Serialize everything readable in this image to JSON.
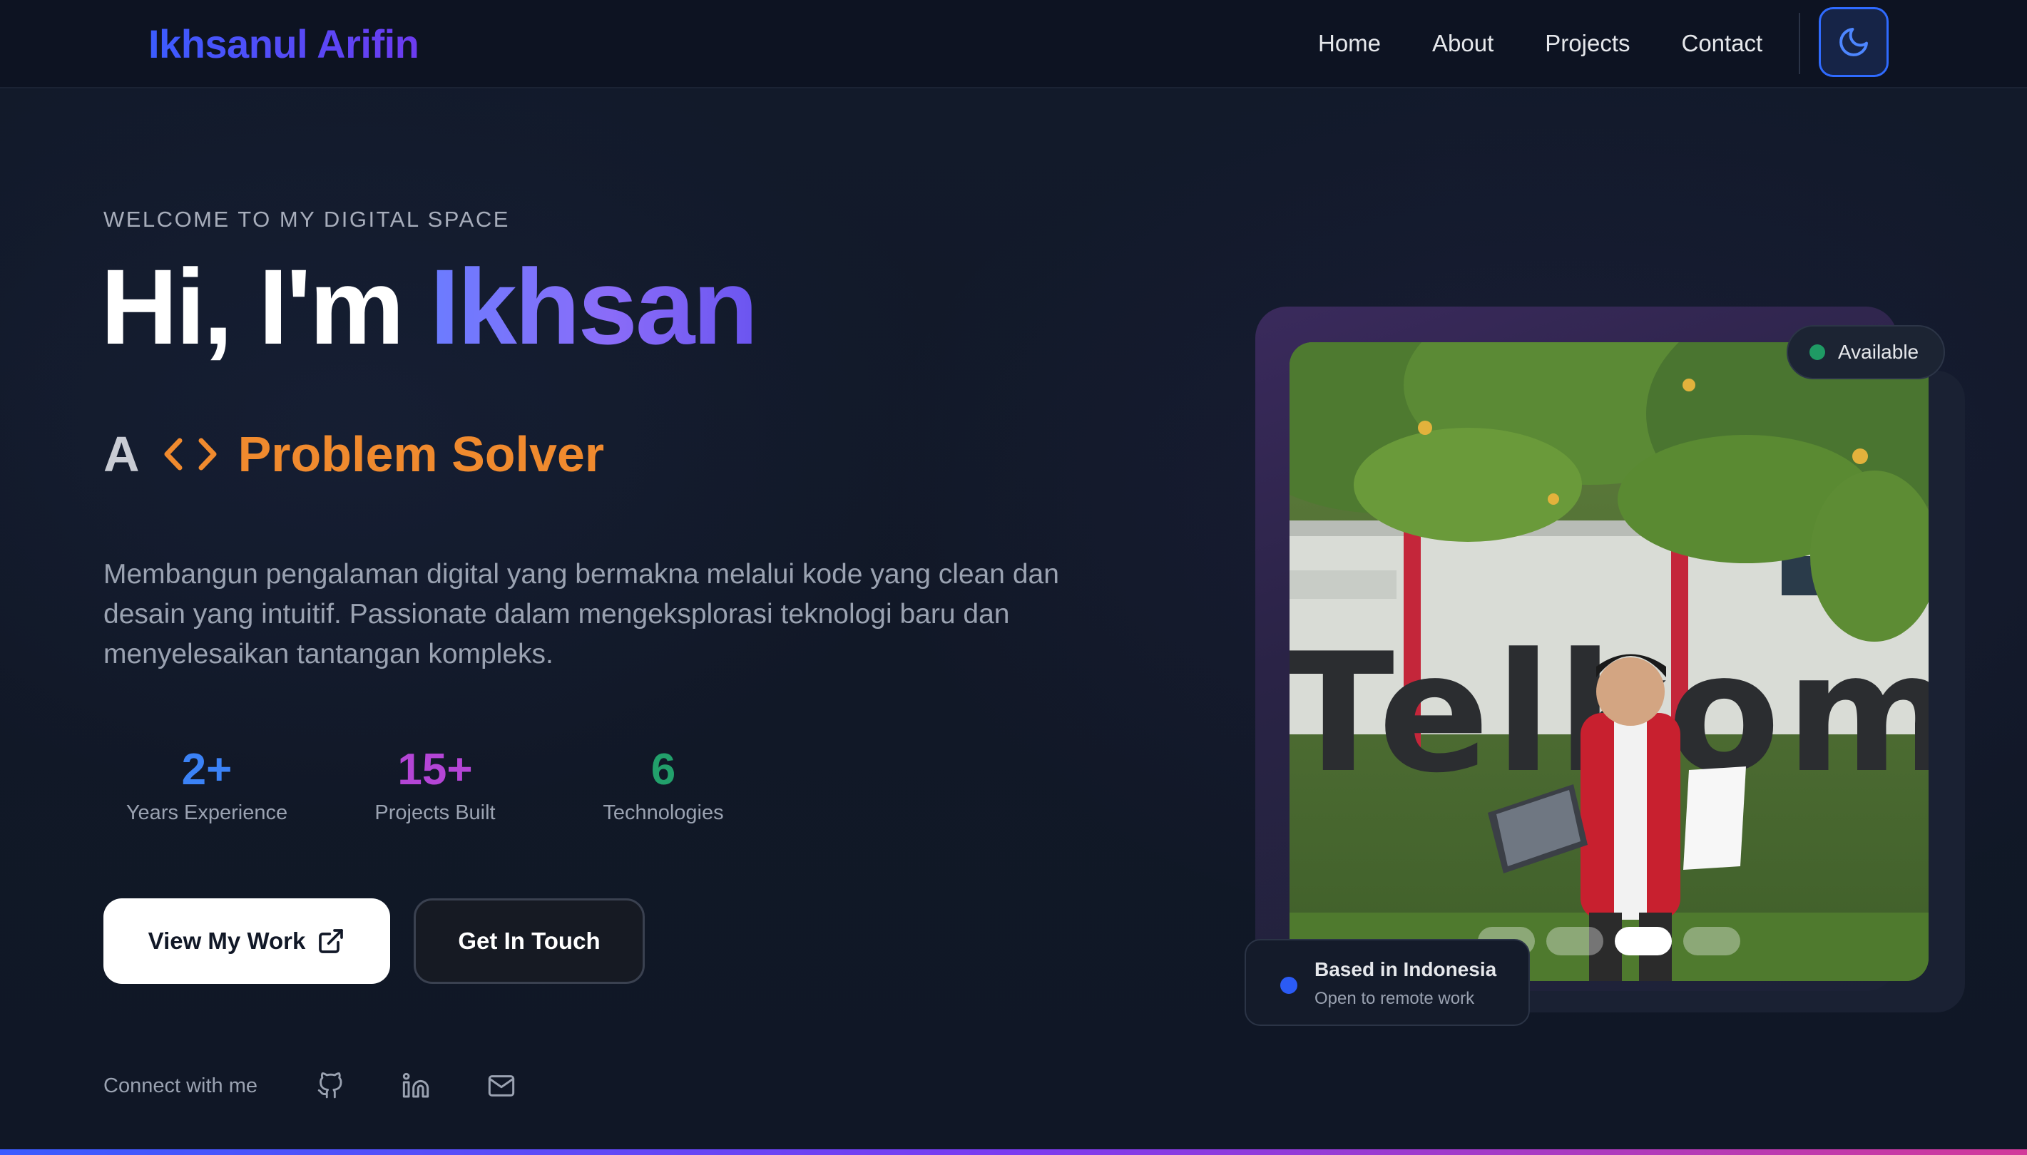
{
  "header": {
    "brand": "Ikhsanul Arifin",
    "nav": [
      {
        "label": "Home"
      },
      {
        "label": "About"
      },
      {
        "label": "Projects"
      },
      {
        "label": "Contact"
      }
    ],
    "theme_toggle_icon": "moon-icon"
  },
  "hero": {
    "eyebrow": "WELCOME TO MY DIGITAL SPACE",
    "greeting": "Hi, I'm ",
    "name": "Ikhsan",
    "role_prefix": "A",
    "role_icon": "code-icon",
    "role": "Problem Solver",
    "description": "Membangun pengalaman digital yang bermakna melalui kode yang clean dan desain yang intuitif. Passionate dalam mengeksplorasi teknologi baru dan menyelesaikan tantangan kompleks.",
    "stats": [
      {
        "value": "2+",
        "label": "Years Experience",
        "color": "#3b82f6"
      },
      {
        "value": "15+",
        "label": "Projects Built",
        "color": "#b445d6"
      },
      {
        "value": "6",
        "label": "Technologies",
        "color": "#22a06b"
      }
    ],
    "buttons": {
      "primary": "View My Work",
      "primary_icon": "external-link-icon",
      "secondary": "Get In Touch"
    },
    "connect_label": "Connect with me",
    "socials": [
      {
        "icon": "github-icon"
      },
      {
        "icon": "linkedin-icon"
      },
      {
        "icon": "mail-icon"
      }
    ]
  },
  "profile_card": {
    "status": "Available",
    "location_title": "Based in Indonesia",
    "location_sub": "Open to remote work",
    "photo_sign_text": "Telkom University",
    "carousel": {
      "count": 4,
      "active": 3
    }
  },
  "colors": {
    "accent": "#2f6bff",
    "role": "#f08a2e",
    "status": "#1f9a64"
  }
}
